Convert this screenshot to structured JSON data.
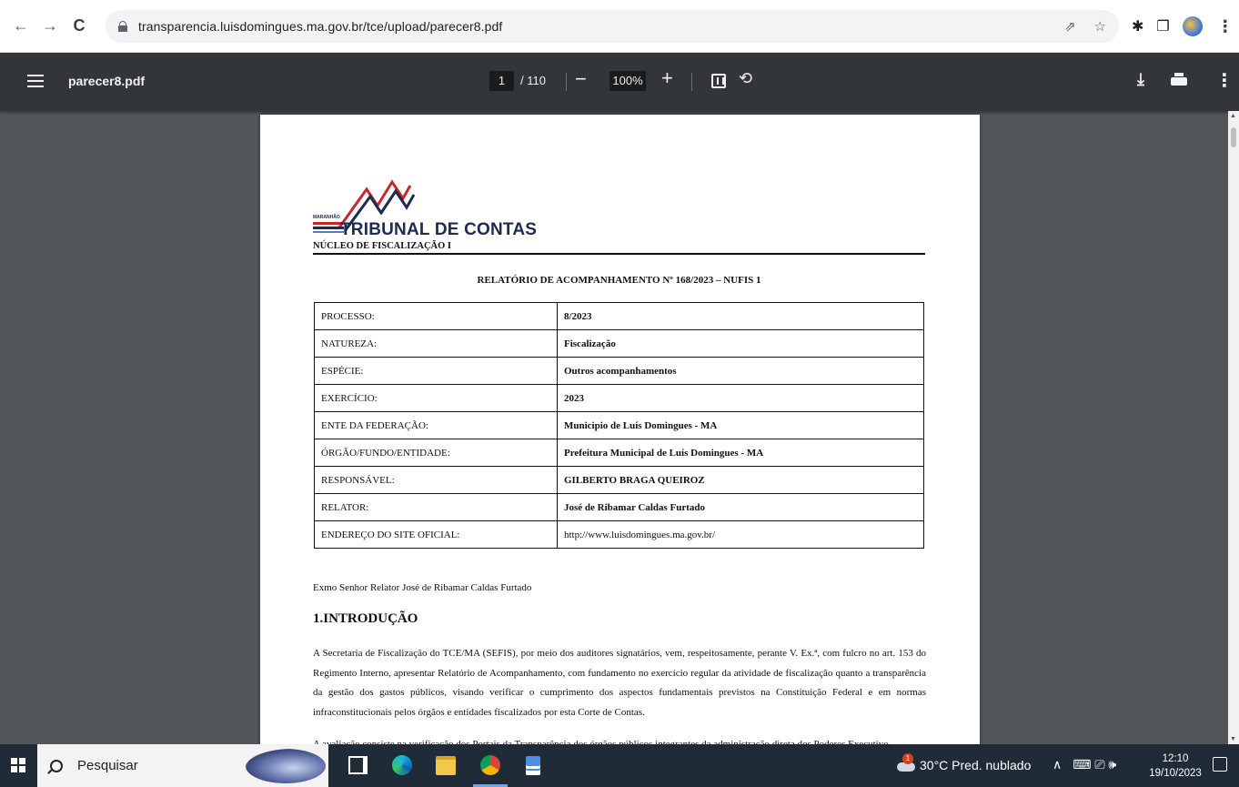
{
  "browser": {
    "url": "transparencia.luisdomingues.ma.gov.br/tce/upload/parecer8.pdf",
    "back_icon": "←",
    "forward_icon": "→",
    "reload_icon": "C",
    "share_icon": "⇗",
    "star_icon": "☆",
    "extensions_icon": "✱",
    "sidepanel_icon": "❐",
    "menu_icon": "⋮"
  },
  "pdf_toolbar": {
    "filename": "parecer8.pdf",
    "current_page": "1",
    "total_pages": "/ 110",
    "zoom_minus": "−",
    "zoom": "100%",
    "zoom_plus": "+",
    "rotate_icon": "⟲",
    "download_icon": "⤓",
    "menu_icon": "⋮"
  },
  "document": {
    "logo_state": "MARANHÃO",
    "logo_title": "TRIBUNAL DE CONTAS",
    "nucleo": "NÚCLEO DE FISCALIZAÇÃO I",
    "report_title": "RELATÓRIO DE ACOMPANHAMENTO Nº 168/2023 – NUFIS 1",
    "rows": [
      {
        "key": "PROCESSO:",
        "value": "8/2023"
      },
      {
        "key": "NATUREZA:",
        "value": "Fiscalização"
      },
      {
        "key": "ESPÉCIE:",
        "value": "Outros acompanhamentos"
      },
      {
        "key": "EXERCÍCIO:",
        "value": "2023"
      },
      {
        "key": "ENTE DA FEDERAÇÃO:",
        "value": "Municipio de Luís Domingues - MA"
      },
      {
        "key": "ÓRGÃO/FUNDO/ENTIDADE:",
        "value": "Prefeitura Municipal de Luís Domingues - MA"
      },
      {
        "key": "RESPONSÁVEL:",
        "value": "GILBERTO BRAGA QUEIROZ"
      },
      {
        "key": "RELATOR:",
        "value": "José de Ribamar Caldas Furtado"
      },
      {
        "key": "ENDEREÇO DO SITE OFICIAL:",
        "value": "http://www.luisdomingues.ma.gov.br/"
      }
    ],
    "salutation": "Exmo Senhor Relator José de Ribamar Caldas Furtado",
    "section_title": "1.INTRODUÇÃO",
    "paragraph_1": "A Secretaria de Fiscalização do TCE/MA (SEFIS), por meio dos auditores signatários, vem, respeitosamente, perante V. Ex.ª, com fulcro no art. 153 do Regimento Interno, apresentar Relatório de Acompanhamento, com fundamento no exercício regular da atividade de fiscalização quanto a transparência da gestão dos gastos públicos, visando verificar o cumprimento dos aspectos fundamentais previstos na Constituição Federal e em normas infraconstitucionais pelos órgãos e entidades fiscalizados por esta Corte de Contas.",
    "paragraph_2": "A avaliação consiste na verificação dos Portais da Transparência dos órgãos públicos integrantes da administração direta dos Poderes Executivo"
  },
  "taskbar": {
    "search_placeholder": "Pesquisar",
    "weather": "30°C  Pred. nublado",
    "tray_chevron": "∧",
    "tray_icons": "⌨  ⎚  🕪",
    "time": "12:10",
    "date": "19/10/2023"
  }
}
